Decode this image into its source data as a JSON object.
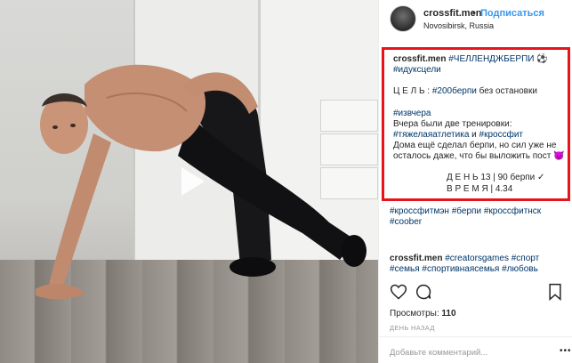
{
  "header": {
    "username": "crossfit.men",
    "separator": "•",
    "follow_label": "Подписаться",
    "location": "Novosibirsk, Russia"
  },
  "caption": {
    "author": "crossfit.men",
    "line1_tag": "#ЧЕЛЛЕНДЖБЕРПИ",
    "line1_emoji": "⚽",
    "line2_tag": "#идуксцели",
    "goal_label": "Ц Е Л Ь :",
    "goal_tag": "#200берпи",
    "goal_rest": "без остановки",
    "yesterday_tag": "#извчера",
    "text1": "Вчера были две тренировки:",
    "text2_tag1": "#тяжелаяатлетика",
    "text2_and": "и",
    "text2_tag2": "#кроссфит",
    "text3": "Дома ещё сделал берпи, но сил уже не",
    "text4": "осталось даже, что бы выложить пост",
    "text4_emoji": "😈",
    "day_line": "Д Е Н Ь 13 | 90 берпи ✓",
    "time_line": "В Р Е М Я | 4.34"
  },
  "after_tags": {
    "line1_tag1": "#кроссфитмэн",
    "line1_tag2": "#берпи",
    "line1_tag3": "#кроссфитнск",
    "line2_tag1": "#coober"
  },
  "comment_first": {
    "author": "crossfit.men",
    "tag1": "#creatorsgames",
    "tag2": "#спорт",
    "tag3": "#семья",
    "tag4": "#спортивнаясемья",
    "tag5": "#любовь"
  },
  "stats": {
    "views_label": "Просмотры:",
    "views_value": "110",
    "time_ago": "ДЕНЬ НАЗАД"
  },
  "comment_box": {
    "placeholder": "Добавьте комментарий...",
    "more": "•••"
  },
  "colors": {
    "accent": "#3897f0",
    "tag": "#003569",
    "highlight": "#e8141b"
  }
}
